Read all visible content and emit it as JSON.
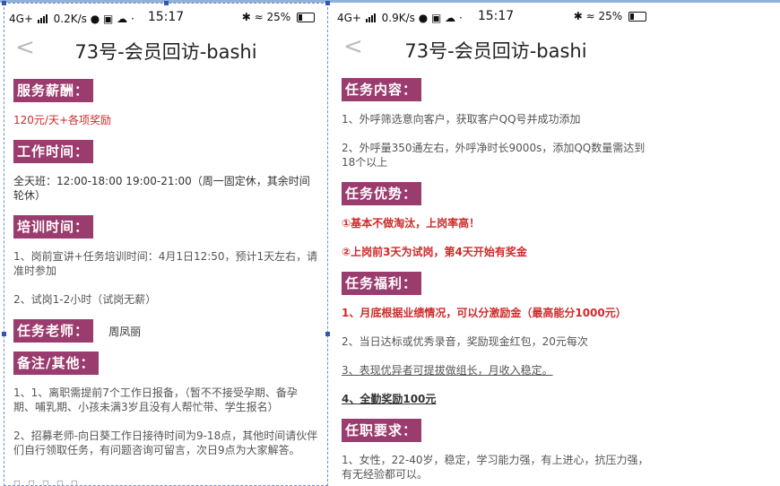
{
  "left": {
    "status": {
      "network": "4G+",
      "speed": "0.2K/s",
      "time": "15:17",
      "battery": "25%"
    },
    "title": "73号-会员回访-bashi",
    "sections": {
      "pay_h": "服务薪酬：",
      "pay": "120元/天+各项奖励",
      "work_h": "工作时间：",
      "work": "全天班：12:00-18:00  19:00-21:00（周一固定休，其余时间轮休）",
      "train_h": "培训时间：",
      "train1": "1、岗前宣讲+任务培训时间：4月1日12:50，预计1天左右，请准时参加",
      "train2": "2、试岗1-2小时（试岗无薪）",
      "teacher_h": "任务老师：",
      "teacher": "周凤丽",
      "notes_h": "备注/其他：",
      "note1": "1、1、离职需提前7个工作日报备，（暂不不接受孕期、备孕期、哺乳期、小孩未满3岁且没有人帮忙带、学生报名）",
      "note2": "2、招募老师-向日葵工作日接待时间为9-18点，其他时间请伙伴们自行领取任务，有问题咨询可留言，次日9点为大家解答。"
    }
  },
  "right": {
    "status": {
      "network": "4G+",
      "speed": "0.9K/s",
      "time": "15:17",
      "battery": "25%"
    },
    "title": "73号-会员回访-bashi",
    "sections": {
      "content_h": "任务内容：",
      "content1": "1、外呼筛选意向客户，获取客户QQ号并成功添加",
      "content2": "2、外呼量350通左右，外呼净时长9000s，添加QQ数量需达到18个以上",
      "adv_h": "任务优势：",
      "adv1": "①基本不做淘汰，上岗率高！",
      "adv2": "②上岗前3天为试岗，第4天开始有奖金",
      "welfare_h": "任务福利：",
      "welfare1": "1、月底根据业绩情况，可以分激励金（最高能分1000元）",
      "welfare2": "2、当日达标或优秀录音，奖励现金红包，20元每次",
      "welfare3": "3、表现优异者可提拔做组长，月收入稳定。",
      "welfare4": "4、全勤奖励100元",
      "req_h": "任职要求：",
      "req1": "1、女性，22-40岁，稳定，学习能力强，有上进心，抗压力强，有无经验都可以。"
    }
  },
  "colors": {
    "heading_bg": "#9b3c6e",
    "red_text": "#cf2a2a"
  }
}
